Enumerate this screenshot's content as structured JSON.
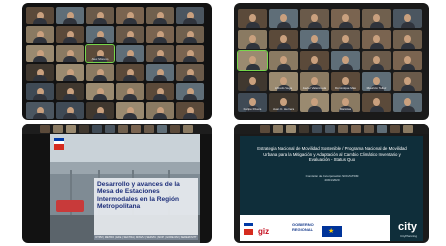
{
  "panel1": {
    "tiles": [
      {
        "name": ""
      },
      {
        "name": ""
      },
      {
        "name": ""
      },
      {
        "name": ""
      },
      {
        "name": ""
      },
      {
        "name": ""
      },
      {
        "name": ""
      },
      {
        "name": ""
      },
      {
        "name": ""
      },
      {
        "name": ""
      },
      {
        "name": ""
      },
      {
        "name": ""
      },
      {
        "name": ""
      },
      {
        "name": ""
      },
      {
        "name": "Alex Moreno"
      },
      {
        "name": ""
      },
      {
        "name": ""
      },
      {
        "name": ""
      },
      {
        "name": ""
      },
      {
        "name": ""
      },
      {
        "name": ""
      },
      {
        "name": ""
      },
      {
        "name": ""
      },
      {
        "name": ""
      },
      {
        "name": ""
      },
      {
        "name": ""
      },
      {
        "name": ""
      },
      {
        "name": ""
      },
      {
        "name": ""
      },
      {
        "name": ""
      },
      {
        "name": ""
      },
      {
        "name": ""
      },
      {
        "name": ""
      },
      {
        "name": ""
      },
      {
        "name": ""
      },
      {
        "name": ""
      }
    ]
  },
  "panel2": {
    "tiles": [
      {
        "name": ""
      },
      {
        "name": ""
      },
      {
        "name": ""
      },
      {
        "name": ""
      },
      {
        "name": ""
      },
      {
        "name": ""
      },
      {
        "name": ""
      },
      {
        "name": ""
      },
      {
        "name": ""
      },
      {
        "name": ""
      },
      {
        "name": ""
      },
      {
        "name": ""
      },
      {
        "name": ""
      },
      {
        "name": ""
      },
      {
        "name": ""
      },
      {
        "name": ""
      },
      {
        "name": ""
      },
      {
        "name": ""
      },
      {
        "name": ""
      },
      {
        "name": "Alfredo Vega"
      },
      {
        "name": "Javier Valenzuela"
      },
      {
        "name": "Dominique Mas"
      },
      {
        "name": "Mauricio Tellez"
      },
      {
        "name": ""
      },
      {
        "name": "Felipe Rivera"
      },
      {
        "name": "Juan C. Herrera"
      },
      {
        "name": ""
      },
      {
        "name": "Mariolas"
      },
      {
        "name": ""
      },
      {
        "name": ""
      }
    ]
  },
  "panel3": {
    "slide_title": "Desarrollo y avances de la Mesa de Estaciones Intermodales en la Región Metropolitana",
    "slide_footer": "DTPM | METRO | EFE | SECTRA | MINVU | SERVIU | MOP | GORE RM | SEREMI MTT"
  },
  "panel4": {
    "slide_title": "Estrategia Nacional de Movilidad Sostenible / Programa Nacional de Movilidad Urbana para la Mitigación y Adaptación al Cambio Climático Inventario y Evaluación - Status Quo",
    "slide_sub_1": "Comisión de Incorporación SOC/GTDM",
    "slide_sub_2": "20/01/2020",
    "logo_giz": "giz",
    "logo_gob_1": "GOBIERNO",
    "logo_gob_2": "REGIONAL",
    "city_name": "city",
    "city_sub": "CityPlanning"
  },
  "colors": {
    "highlight": "#76d64a",
    "slide_blue": "#1e2f7a",
    "slide4_bg": "#0f2e3a"
  }
}
